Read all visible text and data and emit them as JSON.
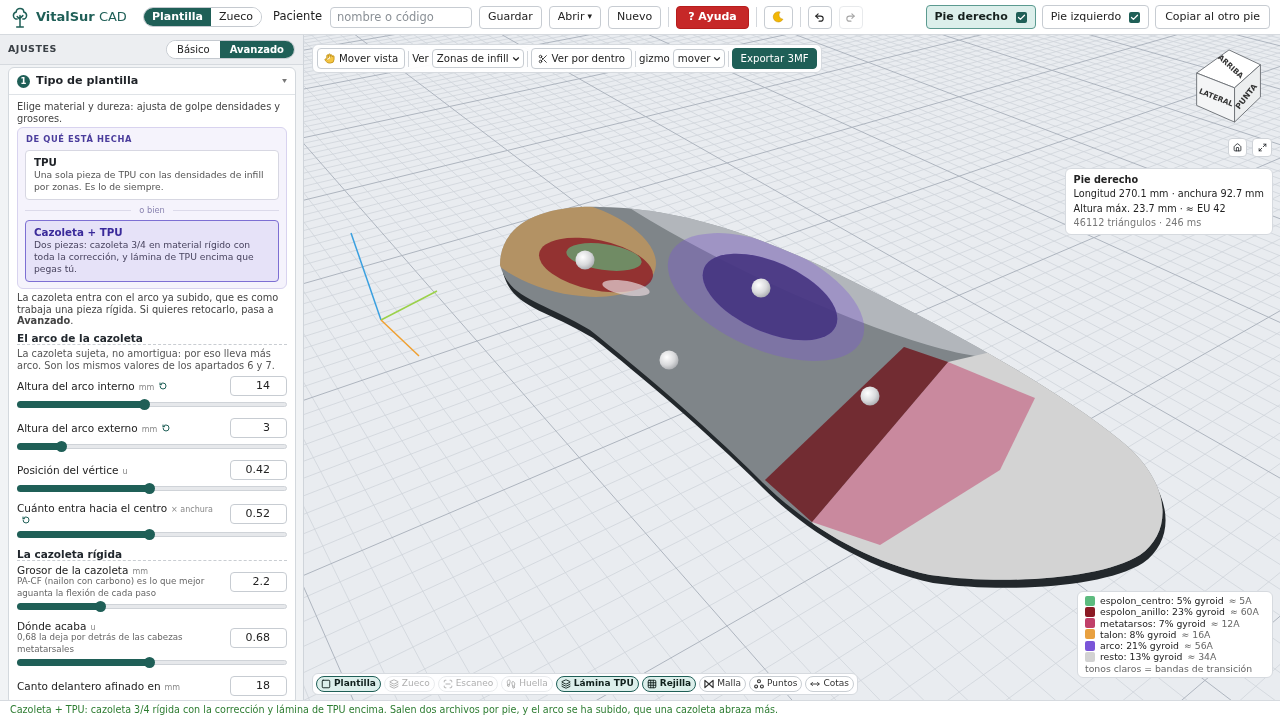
{
  "app": {
    "title": "**VitalSur** CAD"
  },
  "product_toggle": [
    {
      "label": "Plantilla",
      "selected": true
    },
    {
      "label": "Zueco",
      "selected": false
    }
  ],
  "patient": {
    "label": "Paciente",
    "placeholder": "nombre o código"
  },
  "actions": [
    {
      "kind": "button",
      "label": "Guardar",
      "disabled": false
    },
    {
      "kind": "menu",
      "label": "Abrir",
      "caret": "▾",
      "disabled": false
    },
    {
      "kind": "button",
      "label": "Nuevo",
      "disabled": false
    },
    {
      "kind": "help",
      "label": "? Ayuda",
      "disabled": false
    },
    {
      "kind": "theme",
      "disabled": false
    },
    {
      "kind": "undo",
      "disabled": false
    },
    {
      "kind": "redo",
      "disabled": true
    }
  ],
  "feet": [
    {
      "label": "Pie derecho",
      "selected": true,
      "checked": true
    },
    {
      "label": "Pie izquierdo",
      "selected": false,
      "checked": true
    }
  ],
  "copy_button": "Copiar al otro pie",
  "settings": {
    "title": "AJUSTES",
    "modes": [
      {
        "label": "Básico",
        "selected": false
      },
      {
        "label": "Avanzado",
        "selected": true
      }
    ],
    "section": {
      "number": "1",
      "title": "Tipo de plantilla",
      "intro": "Elige material y dureza: ajusta de golpe densidades y grosores.",
      "material": {
        "title": "DE QUÉ ESTÁ HECHA",
        "separator": "o bien",
        "options": [
          {
            "title": "TPU",
            "description": "Una sola pieza de TPU con las densidades de infill por zonas. Es lo de siempre.",
            "selected": false
          },
          {
            "title": "Cazoleta + TPU",
            "description": "Dos piezas: cazoleta 3/4 en material rígido con toda la corrección, y lámina de TPU encima que pegas tú.",
            "selected": true
          }
        ]
      },
      "note": "La cazoleta entra con el arco ya subido, que es como trabaja una pieza rígida. Si quieres retocarlo, pasa a **Avanzado**.",
      "groups": [
        {
          "title": "El arco de la cazoleta",
          "description": "La cazoleta sujeta, no amortigua: por eso lleva más arco. Son los mismos valores de los apartados 6 y 7.",
          "sliders": [
            {
              "label": "Altura del arco interno",
              "unit": "mm",
              "reset": true,
              "value": "14",
              "level": 0.47
            },
            {
              "label": "Altura del arco externo",
              "unit": "mm",
              "reset": true,
              "value": "3",
              "level": 0.15
            },
            {
              "label": "Posición del vértice",
              "unit": "u",
              "reset": false,
              "value": "0.42",
              "level": 0.49
            },
            {
              "label": "Cuánto entra hacia el centro",
              "unit": "× anchura",
              "reset": true,
              "value": "0.52",
              "level": 0.49
            }
          ]
        },
        {
          "title": "La cazoleta rígida",
          "sliders": [
            {
              "label": "Grosor de la cazoleta",
              "unit": "mm",
              "hint": "PA-CF (nailon con carbono) es lo que mejor aguanta la flexión de cada paso",
              "reset": false,
              "value": "2.2",
              "level": 0.3
            },
            {
              "label": "Dónde acaba",
              "unit": "u",
              "hint": "0,68 la deja por detrás de las cabezas metatarsales",
              "reset": false,
              "value": "0.68",
              "level": 0.49
            },
            {
              "label": "Canto delantero afinado en",
              "unit": "mm",
              "reset": false,
              "value": "18"
            }
          ]
        }
      ]
    }
  },
  "viewport": {
    "toolbar": [
      {
        "kind": "pan",
        "label": "Mover vista"
      },
      {
        "kind": "select",
        "label": "Ver",
        "value": "Zonas de infill"
      },
      {
        "kind": "cut",
        "label": "Ver por dentro"
      },
      {
        "kind": "select",
        "label": "gizmo",
        "value": "mover"
      },
      {
        "kind": "export",
        "label": "Exportar 3MF"
      }
    ],
    "view_cube": {
      "top": "ARRIBA",
      "front": "LATERAL",
      "side": "PUNTA"
    },
    "info": {
      "title": "Pie derecho",
      "lines": [
        "Longitud 270.1 mm · anchura 92.7 mm",
        "Altura máx. 23.7 mm · ≈ EU 42"
      ],
      "stats": "46112 triángulos · 246 ms"
    },
    "legend": {
      "items": [
        {
          "label": "espolon_centro: 5% gyroid",
          "hardness": "≈ 5A",
          "color": "#5dbb7f"
        },
        {
          "label": "espolon_anillo: 23% gyroid",
          "hardness": "≈ 60A",
          "color": "#8b1a24"
        },
        {
          "label": "metatarsos: 7% gyroid",
          "hardness": "≈ 12A",
          "color": "#c0406a"
        },
        {
          "label": "talon: 8% gyroid",
          "hardness": "≈ 16A",
          "color": "#e8a040"
        },
        {
          "label": "arco: 21% gyroid",
          "hardness": "≈ 56A",
          "color": "#7a55d8"
        },
        {
          "label": "resto: 13% gyroid",
          "hardness": "≈ 34A",
          "color": "#d3d3d3"
        }
      ],
      "note": "tonos claros = bandas de transición"
    },
    "layers": [
      {
        "kind": "sole",
        "label": "Plantilla",
        "on": true,
        "disabled": false
      },
      {
        "kind": "clog",
        "label": "Zueco",
        "on": false,
        "disabled": true
      },
      {
        "kind": "scan",
        "label": "Escaneo",
        "on": false,
        "disabled": true
      },
      {
        "kind": "print",
        "label": "Huella",
        "on": false,
        "disabled": true
      },
      {
        "kind": "sheet",
        "label": "Lámina TPU",
        "on": true,
        "disabled": false
      },
      {
        "kind": "grid",
        "label": "Rejilla",
        "on": true,
        "disabled": false
      },
      {
        "kind": "mesh",
        "label": "Malla",
        "on": false,
        "disabled": false
      },
      {
        "kind": "points",
        "label": "Puntos",
        "on": false,
        "disabled": false
      },
      {
        "kind": "dims",
        "label": "Cotas",
        "on": false,
        "disabled": false
      }
    ]
  },
  "status": "Cazoleta + TPU: cazoleta 3/4 rígida con la corrección y lámina de TPU encima. Salen dos archivos por pie, y el arco se ha subido, que una cazoleta abraza más."
}
